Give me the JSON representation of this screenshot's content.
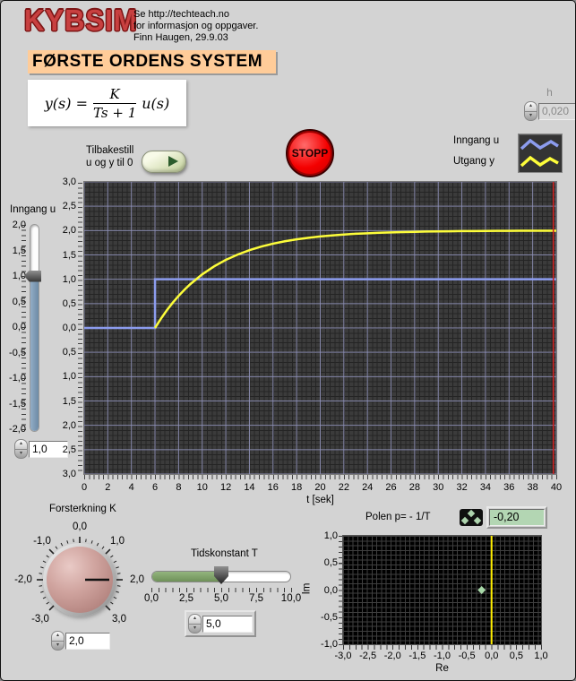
{
  "header": {
    "logo": "KYBSIM",
    "info_lines": [
      "Se http://techteach.no",
      "for informasjon og oppgaver.",
      "Finn Haugen, 29.9.03"
    ],
    "title": "FØRSTE ORDENS SYSTEM"
  },
  "formula": {
    "lhs": "y(s) =",
    "num": "K",
    "den": "Ts + 1",
    "rhs": "u(s)"
  },
  "h_control": {
    "label": "h",
    "value": "0,020"
  },
  "reset": {
    "line1": "Tilbakestill",
    "line2": "u og y til 0"
  },
  "stop": {
    "label": "STOPP"
  },
  "legend": {
    "input": "Inngang u",
    "output": "Utgang y"
  },
  "input_slider": {
    "label": "Inngang u",
    "scale": [
      "2,0",
      "1,5",
      "1,0",
      "0,5",
      "0,0",
      "-0,5",
      "-1,0",
      "-1,5",
      "-2,0"
    ],
    "min": -2,
    "max": 2,
    "value": 1,
    "value_display": "1,0"
  },
  "gain_knob": {
    "label": "Forsterkning K",
    "min": -3,
    "max": 3,
    "value": 2,
    "value_display": "2,0",
    "labels": [
      {
        "text": "0,0",
        "pos": "top"
      },
      {
        "text": "1,0",
        "pos": "ur"
      },
      {
        "text": "2,0",
        "pos": "r"
      },
      {
        "text": "3,0",
        "pos": "br"
      },
      {
        "text": "-1,0",
        "pos": "ul"
      },
      {
        "text": "-2,0",
        "pos": "l"
      },
      {
        "text": "-3,0",
        "pos": "bl"
      }
    ]
  },
  "time_constant": {
    "label": "Tidskonstant T",
    "scale": [
      "0,0",
      "2,5",
      "5,0",
      "7,5",
      "10,0"
    ],
    "min": 0,
    "max": 10,
    "value": 5,
    "value_display": "5,0"
  },
  "pole_panel": {
    "title": "Polen p= - 1/T",
    "value_display": "-0,20",
    "im_label": "Im",
    "re_label": "Re"
  },
  "chart_data": [
    {
      "id": "main",
      "type": "line",
      "xlabel": "t [sek]",
      "xlim": [
        0,
        40
      ],
      "ylim": [
        -3,
        3
      ],
      "x_major": 2,
      "y_major": 0.5,
      "grid": true,
      "x_tick_labels": [
        "0",
        "2",
        "4",
        "6",
        "8",
        "10",
        "12",
        "14",
        "16",
        "18",
        "20",
        "22",
        "24",
        "26",
        "28",
        "30",
        "32",
        "34",
        "36",
        "38",
        "40"
      ],
      "y_tick_labels": [
        "3,0",
        "2,5",
        "2,0",
        "1,5",
        "1,0",
        "0,5",
        "0,0",
        "0,5",
        "1,0",
        "1,5",
        "2,0",
        "2,5",
        "3,0"
      ],
      "grid_color": "#9193ba",
      "cursor_x": 39.75,
      "cursor_color": "#cf2020",
      "series": [
        {
          "name": "Inngang u",
          "color": "#8c9cee",
          "points": [
            [
              0,
              0
            ],
            [
              6,
              0
            ],
            [
              6,
              1
            ],
            [
              40,
              1
            ]
          ]
        },
        {
          "name": "Utgang y",
          "color": "#fdfd3a",
          "points": [
            [
              6,
              0
            ],
            [
              6.5,
              0.19
            ],
            [
              7,
              0.363
            ],
            [
              7.5,
              0.518
            ],
            [
              8,
              0.659
            ],
            [
              8.5,
              0.787
            ],
            [
              9,
              0.902
            ],
            [
              10,
              1.101
            ],
            [
              11,
              1.264
            ],
            [
              12,
              1.398
            ],
            [
              13,
              1.507
            ],
            [
              14,
              1.598
            ],
            [
              15,
              1.671
            ],
            [
              16,
              1.731
            ],
            [
              17,
              1.78
            ],
            [
              18,
              1.819
            ],
            [
              19,
              1.852
            ],
            [
              20,
              1.879
            ],
            [
              21,
              1.901
            ],
            [
              22,
              1.919
            ],
            [
              23,
              1.934
            ],
            [
              24,
              1.945
            ],
            [
              25,
              1.955
            ],
            [
              26,
              1.963
            ],
            [
              27,
              1.97
            ],
            [
              28,
              1.975
            ],
            [
              29,
              1.98
            ],
            [
              30,
              1.983
            ],
            [
              31,
              1.986
            ],
            [
              32,
              1.989
            ],
            [
              33,
              1.991
            ],
            [
              34,
              1.992
            ],
            [
              35,
              1.994
            ],
            [
              36,
              1.995
            ],
            [
              37,
              1.996
            ],
            [
              38,
              1.996
            ],
            [
              39,
              1.997
            ],
            [
              40,
              1.998
            ]
          ]
        }
      ]
    },
    {
      "id": "pole",
      "type": "scatter",
      "xlabel": "Re",
      "ylabel": "Im",
      "xlim": [
        -3,
        1
      ],
      "ylim": [
        -1,
        1
      ],
      "x_tick_labels": [
        "-3,0",
        "-2,5",
        "-2,0",
        "-1,5",
        "-1,0",
        "-0,5",
        "0,0",
        "0,5",
        "1,0"
      ],
      "y_tick_labels": [
        "1,0",
        "0,5",
        "0,0",
        "-0,5",
        "-1,0"
      ],
      "axis_line_x": 0,
      "axis_line_color": "#ffee00",
      "marker_color": "#a8d8a8",
      "points": [
        [
          -0.2,
          0
        ]
      ]
    }
  ]
}
